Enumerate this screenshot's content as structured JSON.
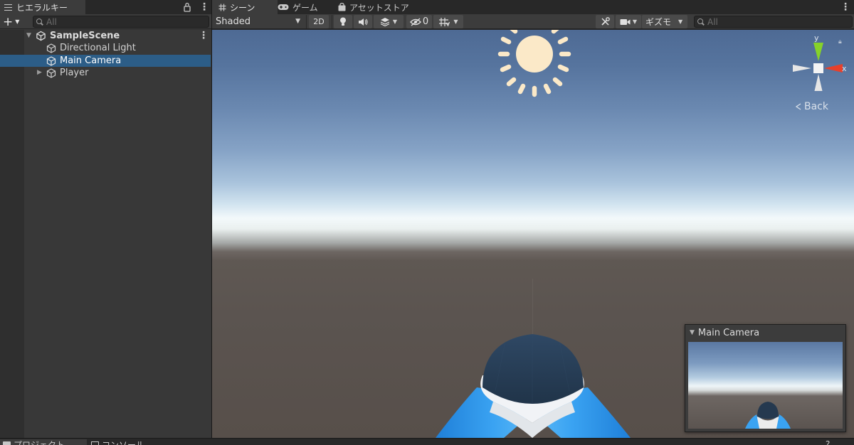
{
  "hierarchy": {
    "tab_label": "ヒエラルキー",
    "add_label": "+",
    "search_placeholder": "All",
    "scene_name": "SampleScene",
    "items": [
      {
        "label": "Directional Light"
      },
      {
        "label": "Main Camera",
        "selected": true
      },
      {
        "label": "Player"
      }
    ]
  },
  "scene_view": {
    "tabs": [
      {
        "label": "シーン",
        "icon": "grid-icon",
        "active": true
      },
      {
        "label": "ゲーム",
        "icon": "gamepad-icon"
      },
      {
        "label": "アセットストア",
        "icon": "shopping-bag-icon"
      }
    ],
    "toolbar": {
      "shading_mode": "Shaded",
      "mode_2d_label": "2D",
      "hidden_count": "0",
      "gizmos_label": "ギズモ",
      "search_placeholder": "All"
    },
    "orientation_gizmo": {
      "y_label": "y",
      "x_label": "x",
      "view_label": "Back"
    },
    "camera_preview": {
      "title": "Main Camera"
    }
  },
  "bottom_tabs": {
    "project_label": "プロジェクト",
    "console_label": "コンソール",
    "help_label": "?"
  },
  "colors": {
    "selection": "#2c5d87",
    "panel_bg": "#383838",
    "axis_x": "#e8402a",
    "axis_y": "#86d22a",
    "player_body": "#2a8ee0",
    "player_head": "#2b3f57"
  }
}
